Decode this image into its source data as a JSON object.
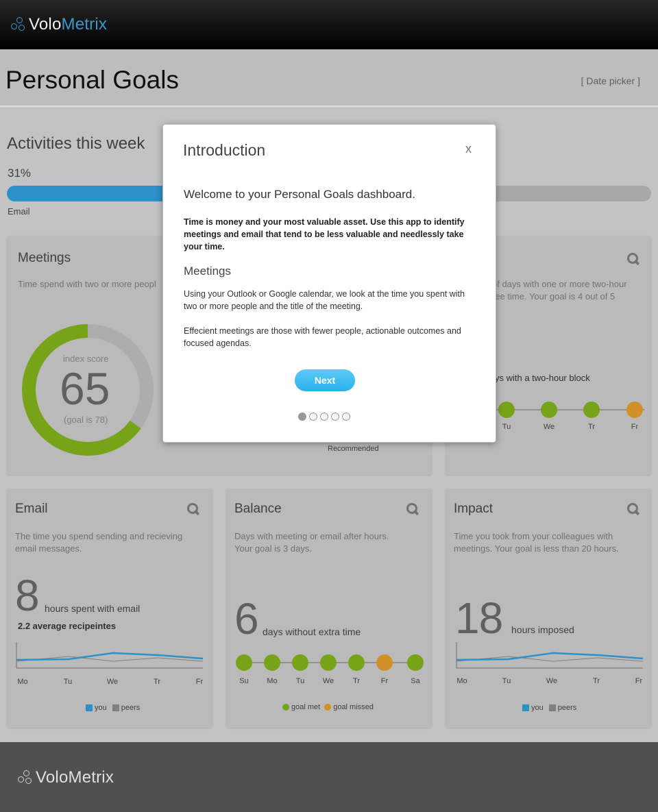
{
  "brand": {
    "name_part1": "Volo",
    "name_part2": "Metrix",
    "footer_name": "VoloMetrix"
  },
  "page": {
    "title": "Personal Goals",
    "date_picker": "[ Date picker ]"
  },
  "activities": {
    "title": "Activities this week",
    "percent_label": "31%",
    "progress": 0.31,
    "bar_label": "Email"
  },
  "meetings_card": {
    "title": "Meetings",
    "description": "Time spend with two or more peopl",
    "index_label": "index score",
    "score": "65",
    "goal": "(goal is 78)",
    "score_value": 65,
    "recommended": "Recommended"
  },
  "focus_card": {
    "description_line1": "of days with one or more two-hour",
    "description_line2": "ree time. Your goal is 4 out of 5",
    "block_label": "ys with a two-hour block",
    "days": [
      "Tu",
      "We",
      "Tr",
      "Fr"
    ],
    "status": [
      "met",
      "met",
      "met",
      "missed"
    ]
  },
  "email_card": {
    "title": "Email",
    "description": "The time you spend sending and recieving email messages.",
    "big_number": "8",
    "big_label": "hours spent with email",
    "sub": "2.2 average recipeintes",
    "days": [
      "Mo",
      "Tu",
      "We",
      "Tr",
      "Fr"
    ],
    "legend_you": "you",
    "legend_peers": "peers"
  },
  "balance_card": {
    "title": "Balance",
    "description": "Days with meeting or email after hours. Your goal is 3 days.",
    "big_number": "6",
    "big_label": "days without extra time",
    "days": [
      "Su",
      "Mo",
      "Tu",
      "We",
      "Tr",
      "Fr",
      "Sa"
    ],
    "status": [
      "met",
      "met",
      "met",
      "met",
      "met",
      "missed",
      "met"
    ],
    "legend_met": "goal met",
    "legend_missed": "goal missed"
  },
  "impact_card": {
    "title": "Impact",
    "description": "Time you took from your colleagues with meetings. Your goal is less than 20 hours.",
    "big_number": "18",
    "big_label": "hours imposed",
    "days": [
      "Mo",
      "Tu",
      "We",
      "Tr",
      "Fr"
    ],
    "legend_you": "you",
    "legend_peers": "peers"
  },
  "modal": {
    "title": "Introduction",
    "close": "x",
    "welcome": "Welcome to your Personal Goals dashboard.",
    "intro_bold": "Time is money and your most valuable asset. Use this app to identify meetings and email that tend to be less valuable and needlessly take your time.",
    "section_title": "Meetings",
    "para1": "Using your Outlook or Google calendar, we look at the time you spent with two or more people and the title of the meeting.",
    "para2": "Effecient meetings are those with fewer people, actionable outcomes and focused agendas.",
    "next": "Next",
    "pages": 5,
    "active_page": 1
  },
  "colors": {
    "accent_blue": "#2f9bd3",
    "goal_met": "#7fae1a",
    "goal_missed": "#e09a2c",
    "peers": "#888888"
  }
}
